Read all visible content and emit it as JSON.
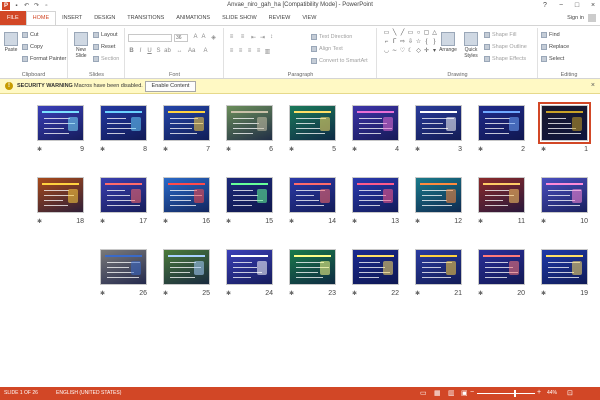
{
  "window": {
    "title": "Anvae_niro_gah_ha [Compatibility Mode] - PowerPoint",
    "app_icon": "P",
    "controls": [
      "?",
      "−",
      "□",
      "×"
    ]
  },
  "tabs": [
    "FILE",
    "HOME",
    "INSERT",
    "DESIGN",
    "TRANSITIONS",
    "ANIMATIONS",
    "SLIDE SHOW",
    "REVIEW",
    "VIEW"
  ],
  "active_tab": "HOME",
  "sign_in": "Sign in",
  "ribbon": {
    "clipboard": {
      "paste": "Paste",
      "cut": "Cut",
      "copy": "Copy",
      "format_painter": "Format Painter",
      "label": "Clipboard"
    },
    "slides": {
      "new_slide": "New Slide",
      "layout": "Layout",
      "reset": "Reset",
      "section": "Section",
      "label": "Slides"
    },
    "font": {
      "size": "36",
      "label": "Font"
    },
    "paragraph": {
      "text_direction": "Text Direction",
      "align_text": "Align Text",
      "convert_smartart": "Convert to SmartArt",
      "label": "Paragraph"
    },
    "drawing": {
      "arrange": "Arrange",
      "quick_styles": "Quick Styles",
      "shape_fill": "Shape Fill",
      "shape_outline": "Shape Outline",
      "shape_effects": "Shape Effects",
      "label": "Drawing"
    },
    "editing": {
      "find": "Find",
      "replace": "Replace",
      "select": "Select",
      "label": "Editing"
    }
  },
  "security_bar": {
    "title": "SECURITY WARNING",
    "message": "Macros have been disabled.",
    "button": "Enable Content"
  },
  "slides": [
    {
      "n": "1",
      "theme": "#1a1a2e",
      "accent": "#c9a227"
    },
    {
      "n": "2",
      "theme": "#1f2a8a",
      "accent": "#6fa8ff"
    },
    {
      "n": "3",
      "theme": "#2a3c9a",
      "accent": "#ffffff"
    },
    {
      "n": "4",
      "theme": "#3d34a8",
      "accent": "#e86fd6"
    },
    {
      "n": "5",
      "theme": "#1b7a5a",
      "accent": "#ffe066"
    },
    {
      "n": "6",
      "theme": "#6b8e5a",
      "accent": "#c9c1a8"
    },
    {
      "n": "7",
      "theme": "#2445a8",
      "accent": "#ffd23f"
    },
    {
      "n": "8",
      "theme": "#2338a0",
      "accent": "#6ad2ff"
    },
    {
      "n": "9",
      "theme": "#3a3fb8",
      "accent": "#7ae0ff"
    },
    {
      "n": "10",
      "theme": "#4a4fc0",
      "accent": "#ff8ad8"
    },
    {
      "n": "11",
      "theme": "#8b2a2a",
      "accent": "#ffcc66"
    },
    {
      "n": "12",
      "theme": "#1a7a8a",
      "accent": "#ff8a3d"
    },
    {
      "n": "13",
      "theme": "#2a3ab0",
      "accent": "#ff5a8a"
    },
    {
      "n": "14",
      "theme": "#2c3aa8",
      "accent": "#ff6a6a"
    },
    {
      "n": "15",
      "theme": "#1d2a7a",
      "accent": "#66ff99"
    },
    {
      "n": "16",
      "theme": "#2a6ac8",
      "accent": "#ff4a4a"
    },
    {
      "n": "17",
      "theme": "#3a3fb0",
      "accent": "#ff6a6a"
    },
    {
      "n": "18",
      "theme": "#a84a1a",
      "accent": "#ffd23f"
    },
    {
      "n": "19",
      "theme": "#1f3aa8",
      "accent": "#ffe066"
    },
    {
      "n": "20",
      "theme": "#2a2f9a",
      "accent": "#ff7a7a"
    },
    {
      "n": "21",
      "theme": "#2a3ca0",
      "accent": "#ffd23f"
    },
    {
      "n": "22",
      "theme": "#1a2a90",
      "accent": "#ffe066"
    },
    {
      "n": "23",
      "theme": "#1a7a4a",
      "accent": "#ffff88"
    },
    {
      "n": "24",
      "theme": "#3a3fb8",
      "accent": "#ffffff"
    },
    {
      "n": "25",
      "theme": "#4a7a3a",
      "accent": "#a8d0ff"
    },
    {
      "n": "26",
      "theme": "#7a7a7a",
      "accent": "#3a6ac8"
    }
  ],
  "slide_star": "✱",
  "status": {
    "slide_count": "SLIDE 1 OF 26",
    "language": "ENGLISH (UNITED STATES)",
    "zoom": "44%"
  },
  "colors": {
    "accent": "#d24726",
    "warning_bg": "#fff9c4"
  }
}
